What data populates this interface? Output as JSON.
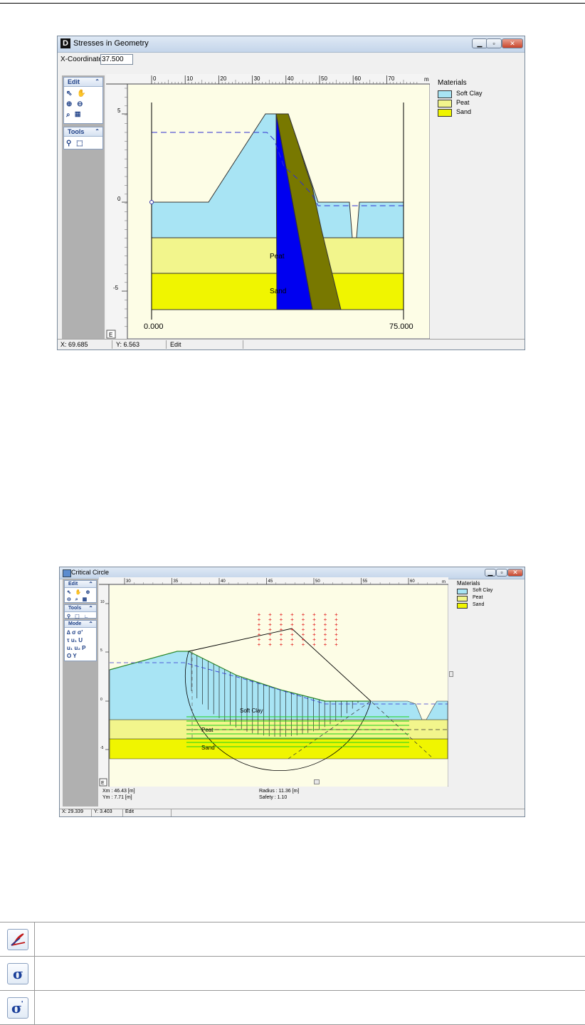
{
  "window1": {
    "title": "Stresses in Geometry",
    "x_coordinate_label": "X-Coordinate",
    "x_coordinate_value": "37.500",
    "panel_groups": [
      "Edit",
      "Tools"
    ],
    "ruler_x_ticks": [
      "0",
      "10",
      "20",
      "30",
      "40",
      "50",
      "60",
      "70"
    ],
    "ruler_unit": "m",
    "ruler_y_ticks": [
      "5",
      "0",
      "-5"
    ],
    "axis_left_label": "0.000",
    "axis_right_label": "75.000",
    "layer_labels": [
      "Peat",
      "Sand"
    ],
    "corner_label": "E",
    "legend": {
      "title": "Materials",
      "items": [
        {
          "name": "Soft Clay",
          "color": "#a8e4f4"
        },
        {
          "name": "Peat",
          "color": "#f2f58c"
        },
        {
          "name": "Sand",
          "color": "#f0f500"
        }
      ]
    },
    "status": {
      "x": "X: 69.685",
      "y": "Y: 6.563",
      "mode": "Edit"
    },
    "colors": {
      "blue_wedge": "#0000f0",
      "olive_wedge": "#787800",
      "canvas_bg": "#fdfde6",
      "phreatic": "#3030d0"
    }
  },
  "window2": {
    "title": "Critical Circle",
    "panel_groups": [
      "Edit",
      "Tools",
      "Mode"
    ],
    "mode_symbols": [
      "σ",
      "σ'",
      "τ",
      "u₁",
      "U",
      "u₁",
      "u₂",
      "P",
      "O",
      "Y"
    ],
    "ruler_x_ticks": [
      "30",
      "35",
      "40",
      "45",
      "50",
      "55",
      "60"
    ],
    "ruler_unit": "m",
    "ruler_y_ticks": [
      "10",
      "5",
      "0",
      "-5"
    ],
    "layer_labels": [
      "Soft Clay",
      "Peat",
      "Sand"
    ],
    "corner_label": "E",
    "results_left": [
      "Xm : 46.43 [m]",
      "Ym : 7.71 [m]"
    ],
    "results_right": [
      "Radius : 11.36 [m]",
      "Safety : 1.10"
    ],
    "legend": {
      "title": "Materials",
      "items": [
        {
          "name": "Soft Clay",
          "color": "#a8e4f4"
        },
        {
          "name": "Peat",
          "color": "#f2f58c"
        },
        {
          "name": "Sand",
          "color": "#f0f500"
        }
      ]
    },
    "status": {
      "x": "X: 29.339",
      "y": "Y: 3.403",
      "mode": "Edit"
    }
  },
  "icon_table": [
    {
      "icon": "slip-circle-icon"
    },
    {
      "icon": "total-stress-sigma-icon"
    },
    {
      "icon": "effective-stress-sigma-prime-icon"
    }
  ]
}
